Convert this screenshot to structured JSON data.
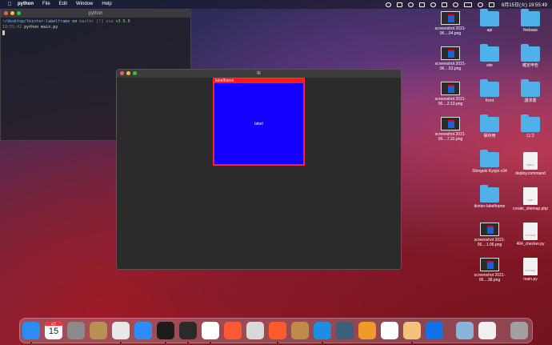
{
  "menubar": {
    "app": "python",
    "items": [
      "File",
      "Edit",
      "Window",
      "Help"
    ],
    "clock": "6月15日(火)  19:55:49"
  },
  "terminal": {
    "title": "python",
    "line1_path": "~/desktop/tkinter-labelframe",
    "line1_on": " on ",
    "line1_branch": "master [!] via",
    "line1_ver": "v3.9.0",
    "line2_time": "19:55:42",
    "line2_cmd": " python main.py"
  },
  "tk": {
    "title": "tk",
    "labelframe_text": "labelframe",
    "label_text": "label"
  },
  "desktop_icons": [
    {
      "type": "shot",
      "label": "screenshot 2021-06....04.png"
    },
    {
      "type": "folder",
      "label": "api"
    },
    {
      "type": "folder",
      "label": "firebase"
    },
    {
      "type": "shot",
      "label": "screenshot 2021-06....53.png"
    },
    {
      "type": "folder",
      "label": "site"
    },
    {
      "type": "folder",
      "label": "確定申告"
    },
    {
      "type": "shot",
      "label": "screenshot 2021-06....2.13.png"
    },
    {
      "type": "folder",
      "label": "front"
    },
    {
      "type": "folder",
      "label": "請求書"
    },
    {
      "type": "shot",
      "label": "screenshot 2021-06....7.31.png"
    },
    {
      "type": "folder",
      "label": "保存用"
    },
    {
      "type": "folder",
      "label": "ロゴ"
    },
    {
      "type": "folder",
      "label": "Shingeki Kyojin v34"
    },
    {
      "type": "doc",
      "label": "deploy.command",
      "tag": "SHELL"
    },
    {
      "type": "folder",
      "label": "tkinter-labelframe"
    },
    {
      "type": "doc",
      "label": "create_sitemap.php",
      "tag": "PHP"
    },
    {
      "type": "shot",
      "label": "screenshot 2021-06....1.06.png"
    },
    {
      "type": "doc",
      "label": "404_checker.py",
      "tag": "PYTHON"
    },
    {
      "type": "shot",
      "label": "screenshot 2021-06....38.png"
    },
    {
      "type": "doc",
      "label": "main.py",
      "tag": "PYTHON"
    }
  ],
  "dock": {
    "calendar_month": "6月",
    "calendar_day": "15",
    "apps": [
      {
        "name": "finder-icon",
        "color": "#2d8cf0"
      },
      {
        "name": "calendar-icon",
        "color": "#ffffff"
      },
      {
        "name": "system-preferences-icon",
        "color": "#8a8a8a"
      },
      {
        "name": "archive-utility-icon",
        "color": "#b89052"
      },
      {
        "name": "chrome-icon",
        "color": "#e8e8e8"
      },
      {
        "name": "zoom-icon",
        "color": "#2d8cff"
      },
      {
        "name": "activity-monitor-icon",
        "color": "#1c1c1c"
      },
      {
        "name": "terminal-icon",
        "color": "#2a2a2a"
      },
      {
        "name": "vscode-icon",
        "color": "#ffffff"
      },
      {
        "name": "safari-compass-icon",
        "color": "#ff5a36"
      },
      {
        "name": "disk-icon",
        "color": "#d9d9d9"
      },
      {
        "name": "stats-icon",
        "color": "#ff5b2e"
      },
      {
        "name": "python-launcher-icon",
        "color": "#c08a4a"
      },
      {
        "name": "docker-icon",
        "color": "#1d8fe0"
      },
      {
        "name": "quicktime-icon",
        "color": "#3c5f7a"
      },
      {
        "name": "network-icon",
        "color": "#f09a2a"
      },
      {
        "name": "postgres-icon",
        "color": "#ffffff"
      },
      {
        "name": "notes-avatar-icon",
        "color": "#f4c27a"
      },
      {
        "name": "infinity-icon",
        "color": "#1273e6"
      },
      {
        "name": "screenshot-icon",
        "color": "#8ab3d9"
      },
      {
        "name": "document-icon",
        "color": "#f0f0f0"
      },
      {
        "name": "trash-icon",
        "color": "#a0a0a0"
      }
    ]
  }
}
